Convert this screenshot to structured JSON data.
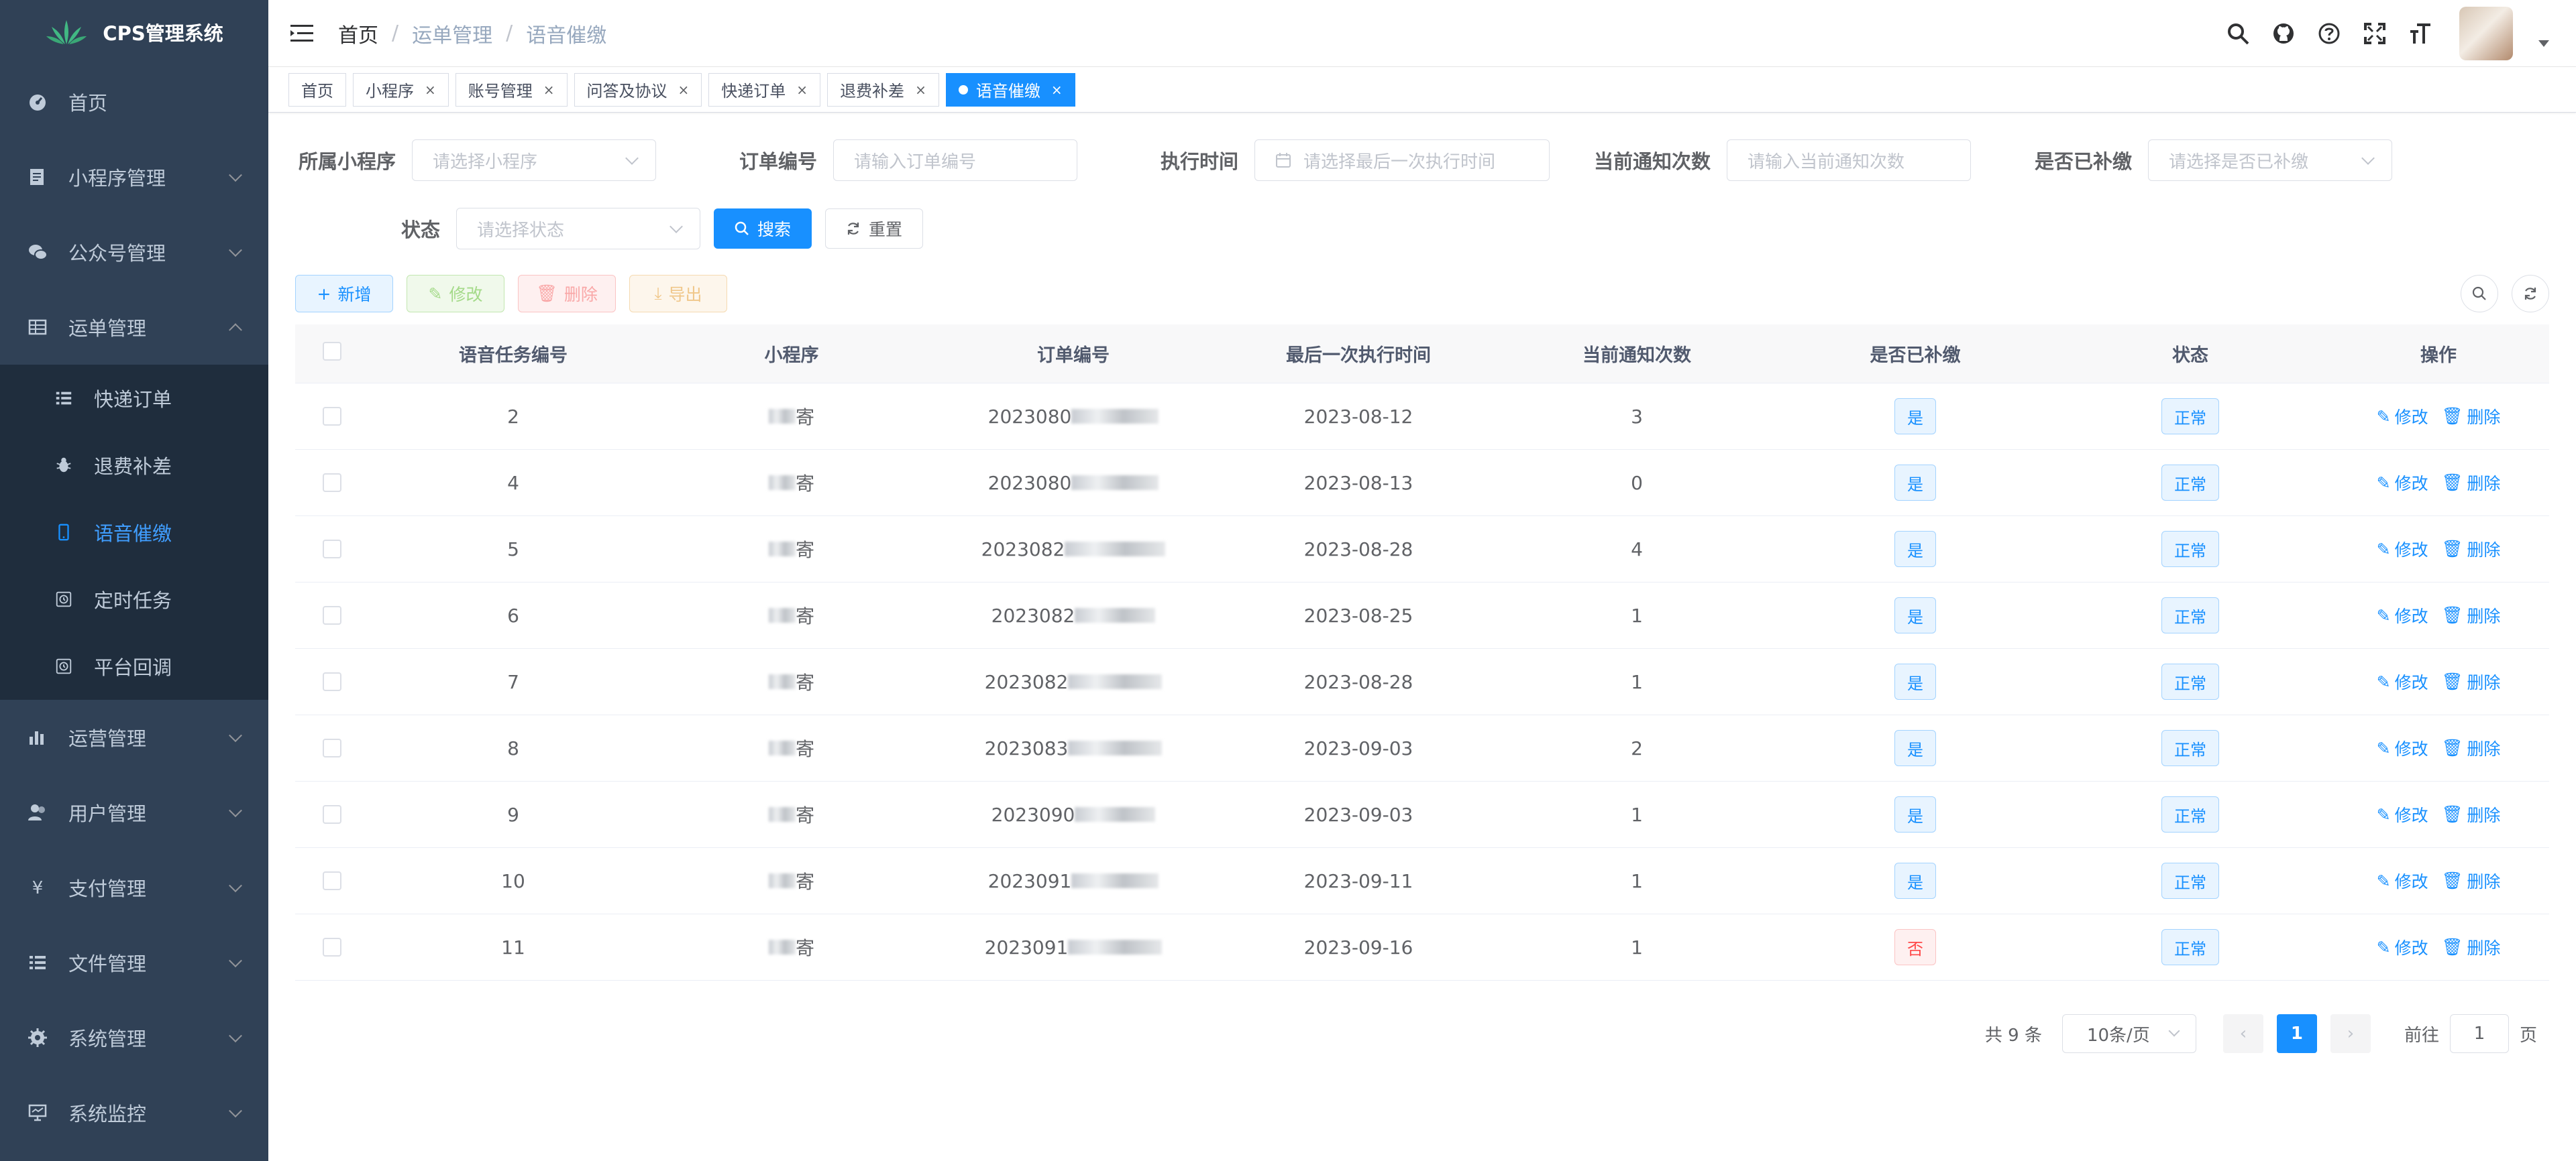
{
  "app": {
    "title": "CPS管理系统"
  },
  "sidebar": {
    "items": [
      {
        "label": "首页",
        "icon": "dashboard-icon"
      },
      {
        "label": "小程序管理",
        "icon": "form-icon"
      },
      {
        "label": "公众号管理",
        "icon": "wechat-icon"
      },
      {
        "label": "运单管理",
        "icon": "table-icon",
        "expanded": true,
        "children": [
          {
            "label": "快递订单",
            "icon": "list-icon"
          },
          {
            "label": "退费补差",
            "icon": "bug-icon"
          },
          {
            "label": "语音催缴",
            "icon": "phone-icon",
            "active": true
          },
          {
            "label": "定时任务",
            "icon": "job-icon"
          },
          {
            "label": "平台回调",
            "icon": "job-icon"
          }
        ]
      },
      {
        "label": "运营管理",
        "icon": "chart-icon"
      },
      {
        "label": "用户管理",
        "icon": "peoples-icon"
      },
      {
        "label": "支付管理",
        "icon": "money-icon"
      },
      {
        "label": "文件管理",
        "icon": "list-icon"
      },
      {
        "label": "系统管理",
        "icon": "system-icon"
      },
      {
        "label": "系统监控",
        "icon": "monitor-icon"
      }
    ]
  },
  "breadcrumb": [
    "首页",
    "运单管理",
    "语音催缴"
  ],
  "tags": [
    {
      "label": "首页",
      "closable": false
    },
    {
      "label": "小程序",
      "closable": true
    },
    {
      "label": "账号管理",
      "closable": true
    },
    {
      "label": "问答及协议",
      "closable": true
    },
    {
      "label": "快递订单",
      "closable": true
    },
    {
      "label": "退费补差",
      "closable": true
    },
    {
      "label": "语音催缴",
      "closable": true,
      "active": true
    }
  ],
  "search": {
    "app_label": "所属小程序",
    "app_placeholder": "请选择小程序",
    "order_label": "订单编号",
    "order_placeholder": "请输入订单编号",
    "time_label": "执行时间",
    "time_placeholder": "请选择最后一次执行时间",
    "count_label": "当前通知次数",
    "count_placeholder": "请输入当前通知次数",
    "paid_label": "是否已补缴",
    "paid_placeholder": "请选择是否已补缴",
    "status_label": "状态",
    "status_placeholder": "请选择状态",
    "search_btn": "搜索",
    "reset_btn": "重置"
  },
  "toolbar": {
    "add": "新增",
    "edit": "修改",
    "delete": "删除",
    "export": "导出"
  },
  "table": {
    "headers": [
      "语音任务编号",
      "小程序",
      "订单编号",
      "最后一次执行时间",
      "当前通知次数",
      "是否已补缴",
      "状态",
      "操作"
    ],
    "rows": [
      {
        "id": "2",
        "app": "寄",
        "order": "2023080",
        "time": "2023-08-12",
        "count": "3",
        "paid": "是",
        "status": "正常"
      },
      {
        "id": "4",
        "app": "寄",
        "order": "2023080",
        "time": "2023-08-13",
        "count": "0",
        "paid": "是",
        "status": "正常"
      },
      {
        "id": "5",
        "app": "寄",
        "order": "2023082",
        "time": "2023-08-28",
        "count": "4",
        "paid": "是",
        "status": "正常"
      },
      {
        "id": "6",
        "app": "寄",
        "order": "2023082",
        "time": "2023-08-25",
        "count": "1",
        "paid": "是",
        "status": "正常"
      },
      {
        "id": "7",
        "app": "寄",
        "order": "2023082",
        "time": "2023-08-28",
        "count": "1",
        "paid": "是",
        "status": "正常"
      },
      {
        "id": "8",
        "app": "寄",
        "order": "2023083",
        "time": "2023-09-03",
        "count": "2",
        "paid": "是",
        "status": "正常"
      },
      {
        "id": "9",
        "app": "寄",
        "order": "2023090",
        "time": "2023-09-03",
        "count": "1",
        "paid": "是",
        "status": "正常"
      },
      {
        "id": "10",
        "app": "寄",
        "order": "2023091",
        "time": "2023-09-11",
        "count": "1",
        "paid": "是",
        "status": "正常"
      },
      {
        "id": "11",
        "app": "寄",
        "order": "2023091",
        "time": "2023-09-16",
        "count": "1",
        "paid": "否",
        "status": "正常"
      }
    ],
    "op_edit": "修改",
    "op_delete": "删除"
  },
  "pagination": {
    "total_text": "共 9 条",
    "page_size": "10条/页",
    "current_page": "1",
    "goto_label": "前往",
    "goto_value": "1",
    "page_unit": "页"
  },
  "colors": {
    "primary": "#1890ff",
    "sidebar_bg": "#304156",
    "submenu_bg": "#1f2d3d",
    "danger": "#ff4949"
  }
}
